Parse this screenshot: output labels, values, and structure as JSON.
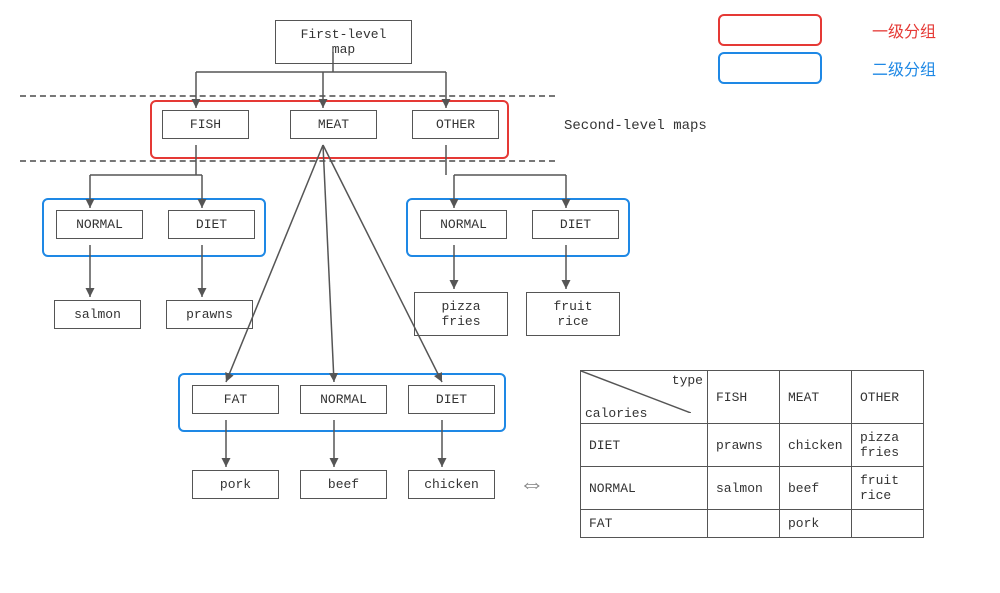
{
  "legend": {
    "first": "一级分组",
    "second": "二级分组"
  },
  "tree": {
    "root": "First-level map",
    "level2_label": "Second-level maps",
    "level2": {
      "fish": "FISH",
      "meat": "MEAT",
      "other": "OTHER"
    },
    "fish_children": {
      "normal": "NORMAL",
      "diet": "DIET"
    },
    "fish_leaves": {
      "salmon": "salmon",
      "prawns": "prawns"
    },
    "other_children": {
      "normal": "NORMAL",
      "diet": "DIET"
    },
    "other_leaves": {
      "pizza": "pizza\nfries",
      "fruit": "fruit\nrice"
    },
    "meat_children": {
      "fat": "FAT",
      "normal": "NORMAL",
      "diet": "DIET"
    },
    "meat_leaves": {
      "pork": "pork",
      "beef": "beef",
      "chicken": "chicken"
    }
  },
  "table": {
    "corner_top": "type",
    "corner_left": "calories",
    "cols": {
      "c1": "FISH",
      "c2": "MEAT",
      "c3": "OTHER"
    },
    "rows": {
      "r1": {
        "h": "DIET",
        "c1": "prawns",
        "c2": "chicken",
        "c3": "pizza\nfries"
      },
      "r2": {
        "h": "NORMAL",
        "c1": "salmon",
        "c2": "beef",
        "c3": "fruit\nrice"
      },
      "r3": {
        "h": "FAT",
        "c1": "",
        "c2": "pork",
        "c3": ""
      }
    }
  },
  "colors": {
    "red": "#e53935",
    "blue": "#1e88e5"
  }
}
